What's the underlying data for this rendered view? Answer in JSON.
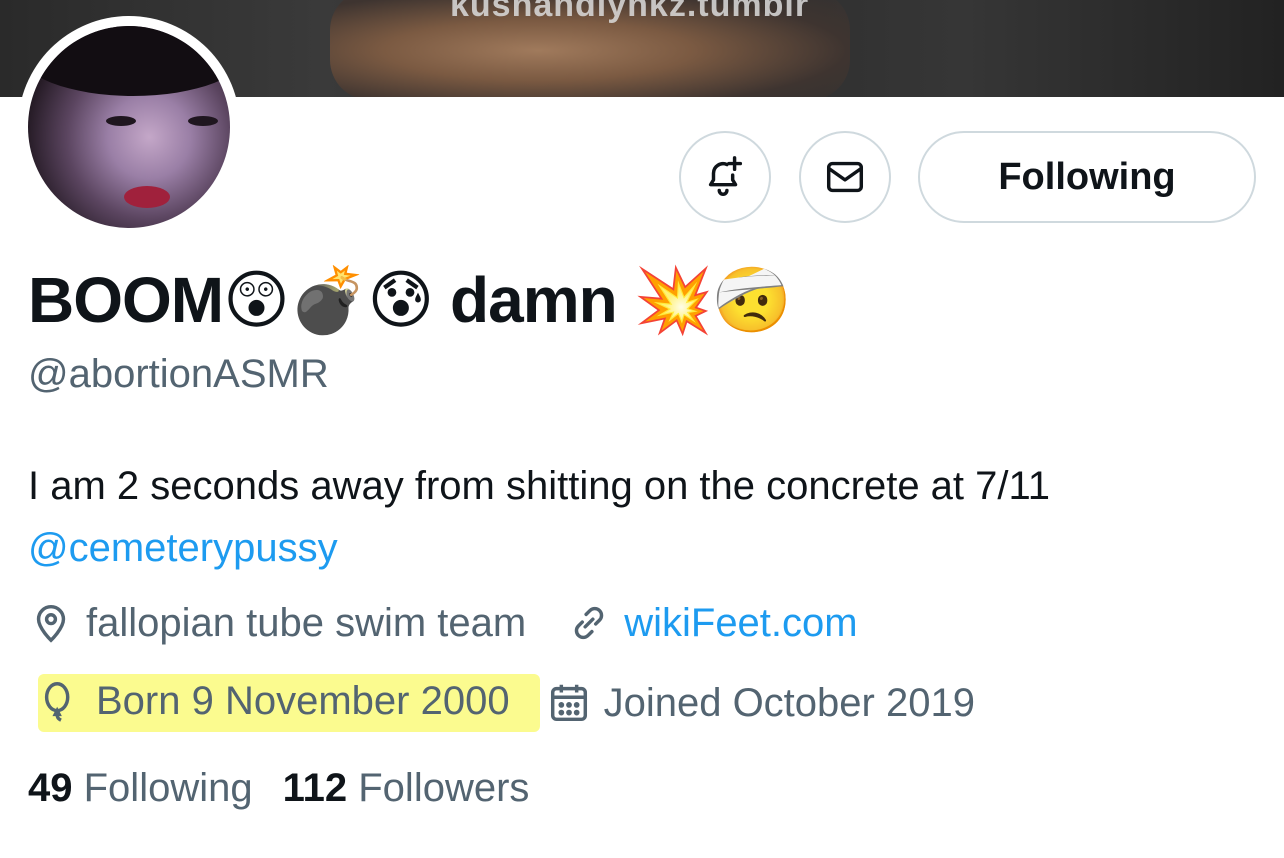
{
  "banner": {
    "watermark": "kushandlynkz.tumblr"
  },
  "actions": {
    "notify_icon": "bell-plus-icon",
    "message_icon": "envelope-icon",
    "follow_label": "Following"
  },
  "profile": {
    "display_name": "BOOM😲💣😰 damn 💥🤕",
    "handle": "@abortionASMR",
    "bio_text": "I am 2 seconds away from shitting on the concrete at 7/11",
    "bio_mention": "@cemeterypussy",
    "location": "fallopian tube swim team",
    "website": "wikiFeet.com",
    "birthday": "Born 9 November 2000",
    "joined": "Joined October 2019"
  },
  "stats": {
    "following_count": "49",
    "following_label": "Following",
    "followers_count": "112",
    "followers_label": "Followers"
  },
  "colors": {
    "link": "#1d9bf0",
    "secondary_text": "#536471",
    "highlight": "#fbfb8f"
  }
}
